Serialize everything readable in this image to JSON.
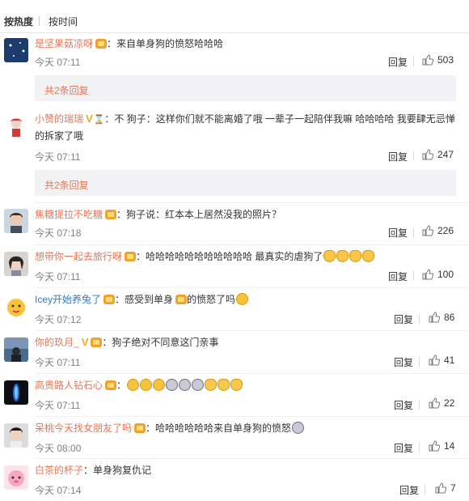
{
  "sort": {
    "hot": "按热度",
    "time": "按时间"
  },
  "reply_label": "回复",
  "comments": [
    {
      "user": "是坚果菇凉呀",
      "text": "：来自单身狗的愤怒哈哈哈",
      "time": "今天 07:11",
      "likes": "503",
      "sub": "共2条回复"
    },
    {
      "user": "小赞的瑞瑞",
      "text": "：不 狗子：这样你们就不能离婚了哦 一辈子一起陪伴我嘛  哈哈哈哈 我要肆无忌惮的拆家了哦",
      "time": "今天 07:11",
      "likes": "247",
      "sub": "共2条回复"
    },
    {
      "user": "焦糖提拉不吃糖",
      "text": "：狗子说：红本本上居然没我的照片？",
      "time": "今天 07:18",
      "likes": "226"
    },
    {
      "user": "想带你一起去旅行呀",
      "text": "：哈哈哈哈哈哈哈哈哈哈哈 最真实的虐狗了",
      "time": "今天 07:11",
      "likes": "100"
    },
    {
      "user": "Icey开始养兔了",
      "text": "：感受到单身",
      "text2": "的愤怒了吗",
      "time": "今天 07:12",
      "likes": "86"
    },
    {
      "user": "你的玖月_",
      "text": "：狗子绝对不同意这门亲事",
      "time": "今天 07:11",
      "likes": "41"
    },
    {
      "user": "高贵路人钻石心",
      "text": "：",
      "time": "今天 07:11",
      "likes": "22"
    },
    {
      "user": "呆桃今天找女朋友了吗",
      "text": "：哈哈哈哈哈哈来自单身狗的愤怒",
      "time": "今天 08:00",
      "likes": "14"
    },
    {
      "user": "白茶的杯子",
      "text": "：单身狗复仇记",
      "time": "今天 07:14",
      "likes": "7"
    }
  ],
  "colors": {
    "username": "#eb7350",
    "accent_blue": "#2f7ad3",
    "time": "#808080",
    "subreply_bg": "#f2f2f5"
  },
  "icons": [
    "thumbs-up-icon",
    "vip-v-icon",
    "hourglass-icon",
    "fan-badge-icon",
    "emoji-icon"
  ]
}
